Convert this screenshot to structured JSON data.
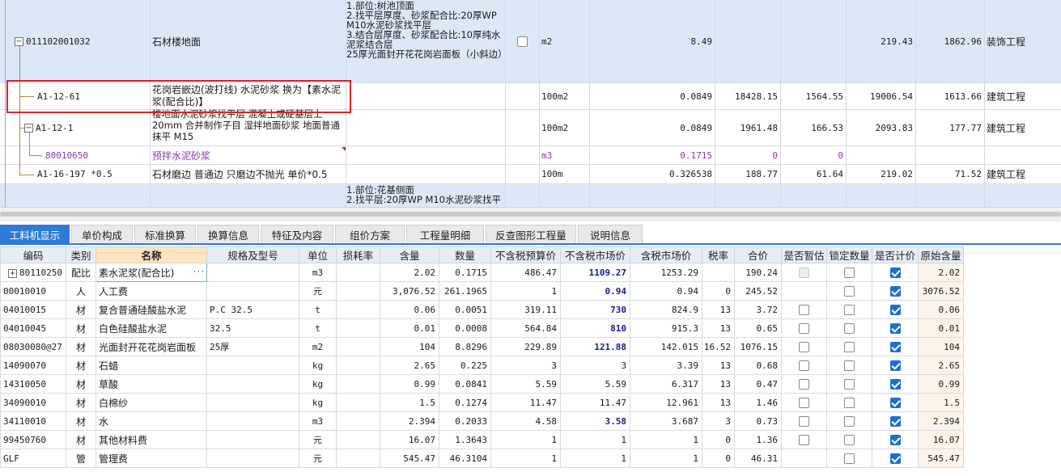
{
  "top_rows": [
    {
      "code": "011102001032",
      "name": "石材楼地面",
      "desc": "1.部位:树池顶面\n2.找平层厚度、砂浆配合比:20厚WP M10水泥砂浆找平层\n3.结合层厚度、砂浆配合比:10厚纯水泥浆结合层\n25厚光面封开花花岗岩面板（小斜边）",
      "unit": "m2",
      "qty": "8.49",
      "price1": "",
      "price2": "",
      "total": "219.43",
      "amount": "1862.96",
      "type": "装饰工程"
    },
    {
      "code": "A1-12-61",
      "name": "花岗岩嵌边(波打线) 水泥砂浆  换为【素水泥浆(配合比)】",
      "unit": "100m2",
      "qty": "0.0849",
      "price1": "18428.15",
      "price2": "1564.55",
      "total": "19006.54",
      "amount": "1613.66",
      "type": "建筑工程"
    },
    {
      "code": "A1-12-1",
      "name": "楼地面水泥砂浆找平层 混凝土或硬基层上 20mm  合并制作子目 湿拌地面砂浆 地面普通抹平 M15",
      "unit": "100m2",
      "qty": "0.0849",
      "price1": "1961.48",
      "price2": "166.53",
      "total": "2093.83",
      "amount": "177.77",
      "type": "建筑工程"
    },
    {
      "code": "80010650",
      "name": "预拌水泥砂浆",
      "unit": "m3",
      "qty": "0.1715",
      "price1": "0",
      "price2": "0",
      "total": "",
      "amount": "",
      "type": ""
    },
    {
      "code": "A1-16-197 *0.5",
      "name": "石材磨边 普通边  只磨边不抛光 单价*0.5",
      "unit": "100m",
      "qty": "0.326538",
      "price1": "188.77",
      "price2": "61.64",
      "total": "219.02",
      "amount": "71.52",
      "type": "建筑工程"
    },
    {
      "desc": "1.部位:花基侧面\n2.找平层:20厚WP M10水泥砂浆找平"
    }
  ],
  "tabs": [
    "工料机显示",
    "单价构成",
    "标准换算",
    "换算信息",
    "特征及内容",
    "组价方案",
    "工程量明细",
    "反查图形工程量",
    "说明信息"
  ],
  "columns": [
    "编码",
    "类别",
    "名称",
    "规格及型号",
    "单位",
    "损耗率",
    "含量",
    "数量",
    "不含税预算价",
    "不含税市场价",
    "含税市场价",
    "税率",
    "合价",
    "是否暂估",
    "锁定数量",
    "是否计价",
    "原始含量"
  ],
  "rows": [
    {
      "code": "80110250",
      "cat": "配比",
      "name": "素水泥浆(配合比)",
      "spec": "",
      "unit": "m3",
      "loss": "",
      "content": "2.02",
      "qty": "0.1715",
      "budget": "486.47",
      "market": "1109.27",
      "taxmarket": "1253.29",
      "tax": "",
      "total": "190.24",
      "est": "disabled",
      "lock": false,
      "priced": true,
      "orig": "2.02"
    },
    {
      "code": "00010010",
      "cat": "人",
      "name": "人工费",
      "spec": "",
      "unit": "元",
      "loss": "",
      "content": "3,076.52",
      "qty": "261.1965",
      "budget": "1",
      "market": "0.94",
      "taxmarket": "0.94",
      "tax": "0",
      "total": "245.52",
      "est": "none",
      "lock": false,
      "priced": true,
      "orig": "3076.52"
    },
    {
      "code": "04010015",
      "cat": "材",
      "name": "复合普通硅酸盐水泥",
      "spec": "P.C 32.5",
      "unit": "t",
      "loss": "",
      "content": "0.06",
      "qty": "0.0051",
      "budget": "319.11",
      "market": "730",
      "taxmarket": "824.9",
      "tax": "13",
      "total": "3.72",
      "est": "off",
      "lock": false,
      "priced": true,
      "orig": "0.06"
    },
    {
      "code": "04010045",
      "cat": "材",
      "name": "白色硅酸盐水泥",
      "spec": "32.5",
      "unit": "t",
      "loss": "",
      "content": "0.01",
      "qty": "0.0008",
      "budget": "564.84",
      "market": "810",
      "taxmarket": "915.3",
      "tax": "13",
      "total": "0.65",
      "est": "off",
      "lock": false,
      "priced": true,
      "orig": "0.01"
    },
    {
      "code": "08030080@27",
      "cat": "材",
      "name": "光面封开花花岗岩面板",
      "spec": "25厚",
      "unit": "m2",
      "loss": "",
      "content": "104",
      "qty": "8.8296",
      "budget": "229.89",
      "market": "121.88",
      "taxmarket": "142.015",
      "tax": "16.52",
      "total": "1076.15",
      "est": "off",
      "lock": false,
      "priced": true,
      "orig": "104"
    },
    {
      "code": "14090070",
      "cat": "材",
      "name": "石蜡",
      "spec": "",
      "unit": "kg",
      "loss": "",
      "content": "2.65",
      "qty": "0.225",
      "budget": "3",
      "market": "3",
      "taxmarket": "3.39",
      "tax": "13",
      "total": "0.68",
      "est": "off",
      "lock": false,
      "priced": true,
      "orig": "2.65"
    },
    {
      "code": "14310050",
      "cat": "材",
      "name": "草酸",
      "spec": "",
      "unit": "kg",
      "loss": "",
      "content": "0.99",
      "qty": "0.0841",
      "budget": "5.59",
      "market": "5.59",
      "taxmarket": "6.317",
      "tax": "13",
      "total": "0.47",
      "est": "off",
      "lock": false,
      "priced": true,
      "orig": "0.99"
    },
    {
      "code": "34090010",
      "cat": "材",
      "name": "白棉纱",
      "spec": "",
      "unit": "kg",
      "loss": "",
      "content": "1.5",
      "qty": "0.1274",
      "budget": "11.47",
      "market": "11.47",
      "taxmarket": "12.961",
      "tax": "13",
      "total": "1.46",
      "est": "off",
      "lock": false,
      "priced": true,
      "orig": "1.5"
    },
    {
      "code": "34110010",
      "cat": "材",
      "name": "水",
      "spec": "",
      "unit": "m3",
      "loss": "",
      "content": "2.394",
      "qty": "0.2033",
      "budget": "4.58",
      "market": "3.58",
      "taxmarket": "3.687",
      "tax": "3",
      "total": "0.73",
      "est": "off",
      "lock": false,
      "priced": true,
      "orig": "2.394"
    },
    {
      "code": "99450760",
      "cat": "材",
      "name": "其他材料费",
      "spec": "",
      "unit": "元",
      "loss": "",
      "content": "16.07",
      "qty": "1.3643",
      "budget": "1",
      "market": "1",
      "taxmarket": "1",
      "tax": "0",
      "total": "1.36",
      "est": "off",
      "lock": false,
      "priced": true,
      "orig": "16.07"
    },
    {
      "code": "GLF",
      "cat": "管",
      "name": "管理费",
      "spec": "",
      "unit": "元",
      "loss": "",
      "content": "545.47",
      "qty": "46.3104",
      "budget": "1",
      "market": "1",
      "taxmarket": "1",
      "tax": "0",
      "total": "46.31",
      "est": "none",
      "lock": false,
      "priced": true,
      "orig": "545.47"
    }
  ],
  "highlight_market_rows": [
    0,
    1,
    2,
    3,
    4,
    8
  ]
}
